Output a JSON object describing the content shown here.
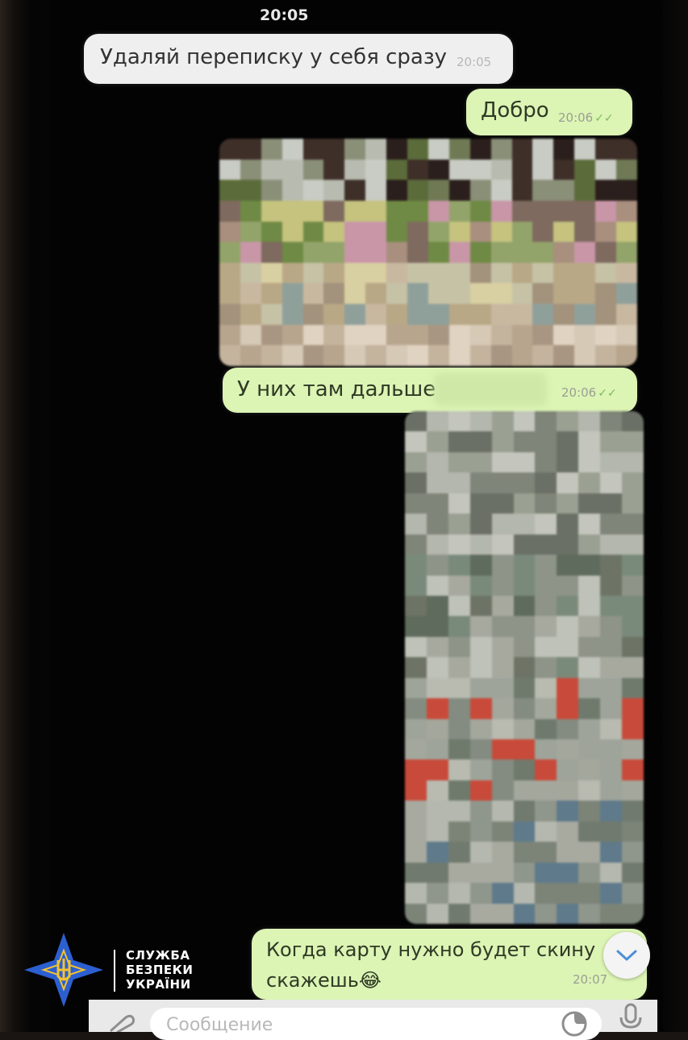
{
  "status_bar": {
    "time": "20:05"
  },
  "messages": [
    {
      "direction": "incoming",
      "text": "Удаляй переписку у себя сразу",
      "time": "20:05"
    },
    {
      "direction": "outgoing",
      "text": "Добро",
      "time": "20:06",
      "read": true
    },
    {
      "direction": "outgoing",
      "type": "photo",
      "pixelated": true
    },
    {
      "direction": "outgoing",
      "text": "У них там дальше",
      "time": "20:06",
      "read": true,
      "redacted_part": true
    },
    {
      "direction": "outgoing",
      "type": "photo",
      "pixelated": true
    },
    {
      "direction": "outgoing",
      "text_line1": "Когда карту нужно будет скину",
      "text_line2": "скажешь",
      "emoji": "😂",
      "time": "20:07"
    }
  ],
  "scroll_down_button": {
    "icon": "chevron-down-icon"
  },
  "composer": {
    "placeholder": "Сообщение",
    "attach_icon": "paperclip-icon",
    "sticker_icon": "sticker-icon",
    "mic_icon": "microphone-icon"
  },
  "watermark": {
    "org_line1": "СЛУЖБА",
    "org_line2": "БЕЗПЕКИ",
    "org_line3": "УКРАЇНИ",
    "logo_color": "#2c5fd0",
    "emblem_color": "#f2c230"
  },
  "colors": {
    "incoming_bubble": "#efefef",
    "outgoing_bubble": "#dcf4b4",
    "screen_background": "#030303"
  }
}
